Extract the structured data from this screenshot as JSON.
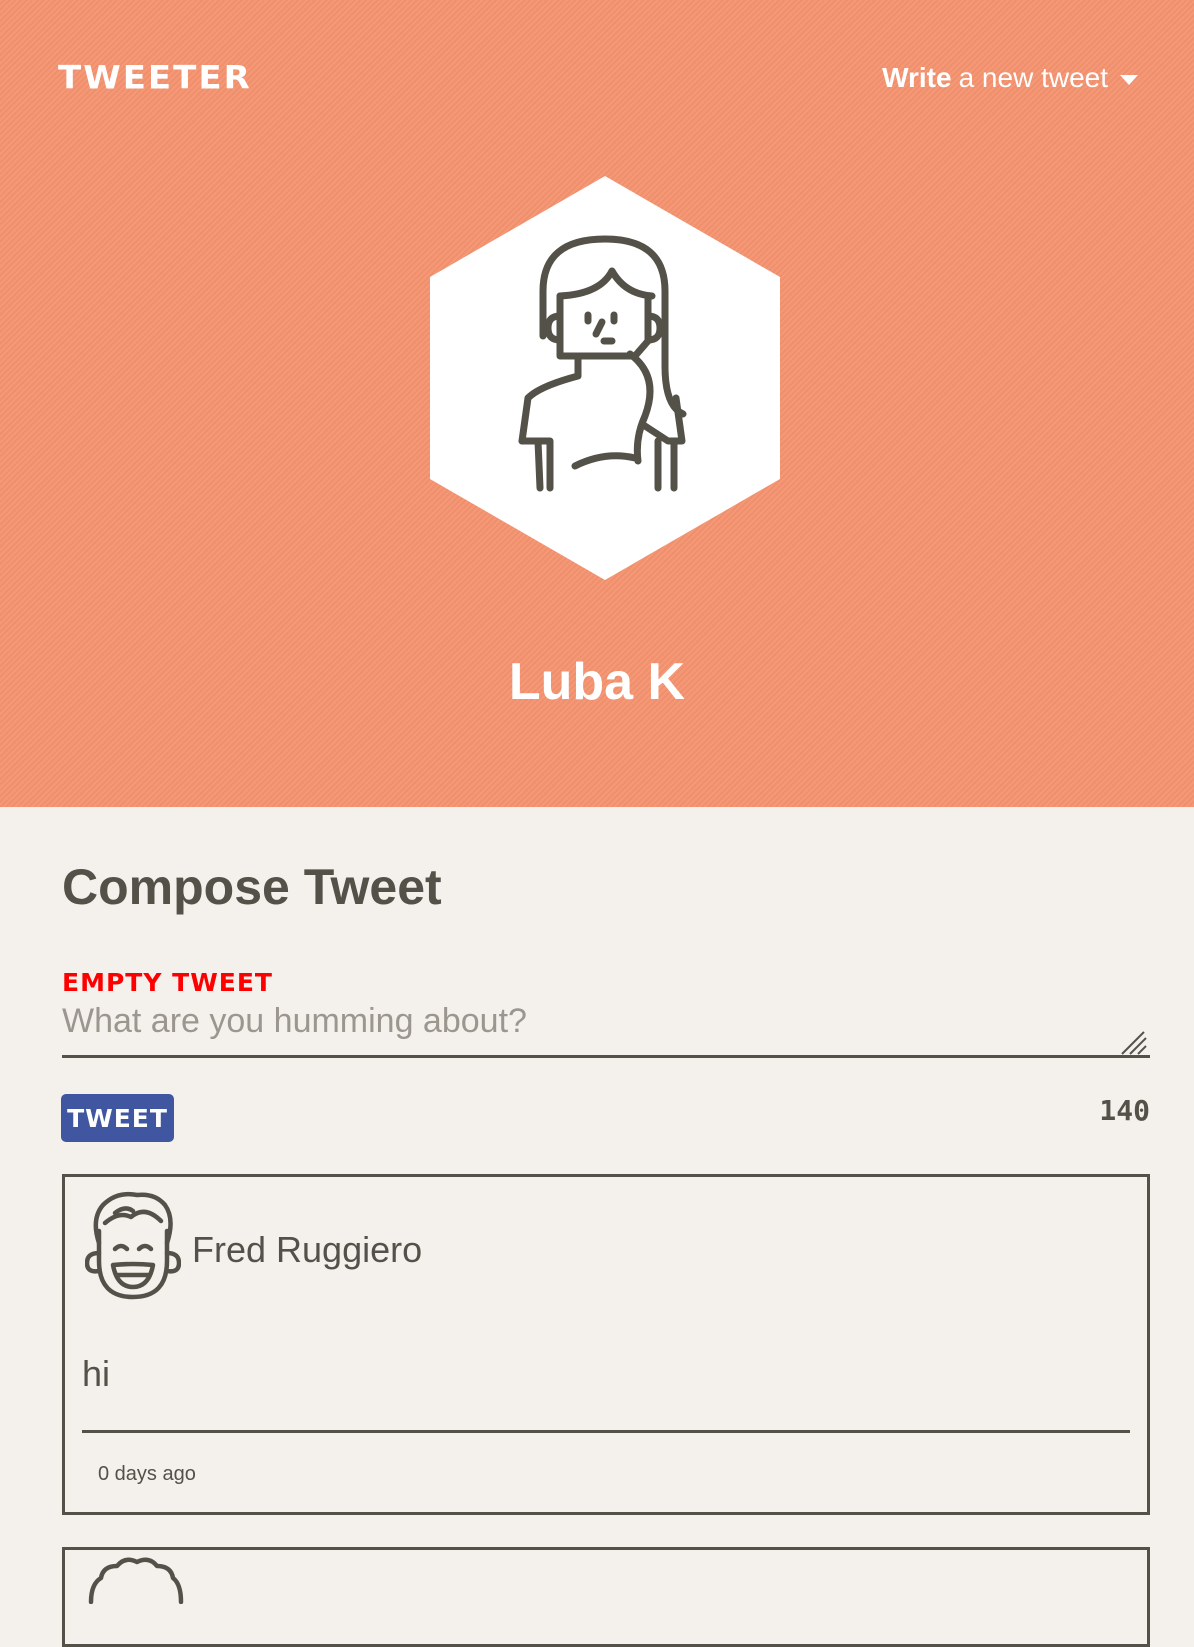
{
  "header": {
    "brand": "TWEETER",
    "write_bold": "Write",
    "write_rest": "a new tweet",
    "caret_icon": "caret-down-icon"
  },
  "profile": {
    "name": "Luba K",
    "avatar_icon": "woman-avatar-icon"
  },
  "compose": {
    "title": "Compose Tweet",
    "error": "EMPTY TWEET",
    "placeholder": "What are you humming about?",
    "button": "TWEET",
    "counter": "140"
  },
  "tweets": [
    {
      "author": "Fred Ruggiero",
      "avatar_icon": "smiling-man-avatar-icon",
      "text": "hi",
      "time": "0 days ago"
    }
  ],
  "colors": {
    "hero": "#f4926f",
    "page": "#f4f1ed",
    "text": "#545149",
    "error": "#ff0000",
    "button": "#4056a1"
  }
}
